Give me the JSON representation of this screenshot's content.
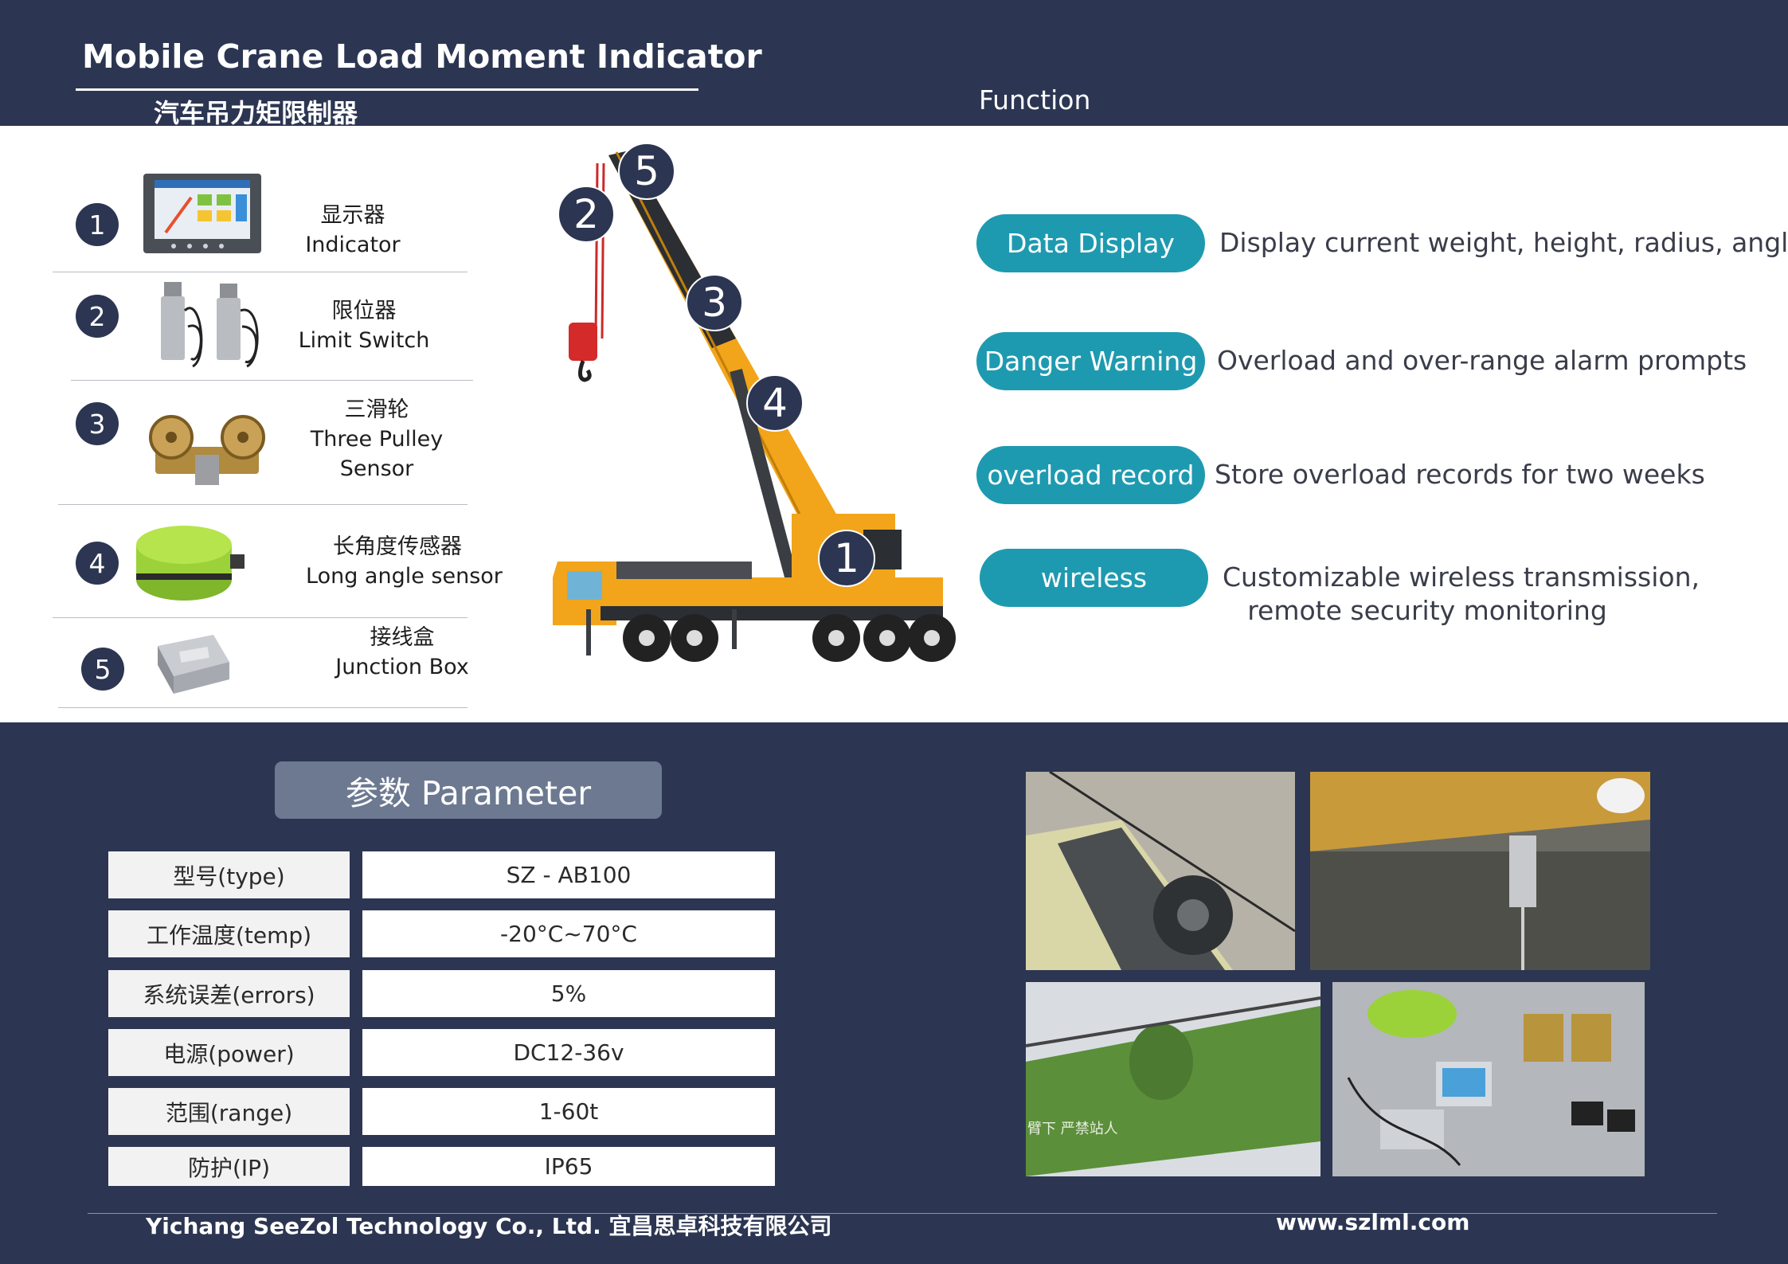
{
  "header": {
    "title": "Mobile Crane Load Moment Indicator",
    "subtitle": "汽车吊力矩限制器",
    "function_label": "Function"
  },
  "components": [
    {
      "num": "1",
      "zh": "显示器",
      "en": "Indicator",
      "icon": "display-unit-icon"
    },
    {
      "num": "2",
      "zh": "限位器",
      "en": "Limit Switch",
      "icon": "limit-switch-icon"
    },
    {
      "num": "3",
      "zh": "三滑轮",
      "en": "Three Pulley",
      "en2": "Sensor",
      "icon": "pulley-sensor-icon"
    },
    {
      "num": "4",
      "zh": "长角度传感器",
      "en": "Long angle sensor",
      "icon": "angle-sensor-icon"
    },
    {
      "num": "5",
      "zh": "接线盒",
      "en": "Junction Box",
      "icon": "junction-box-icon"
    }
  ],
  "crane_badges": [
    "5",
    "2",
    "3",
    "4",
    "1"
  ],
  "functions": [
    {
      "label": "Data Display",
      "desc": "Display current weight, height, radius, angle"
    },
    {
      "label": "Danger Warning",
      "desc": "Overload and over-range alarm prompts"
    },
    {
      "label": "overload record",
      "desc": "Store overload records for two weeks"
    },
    {
      "label": "wireless",
      "desc": "Customizable wireless transmission,",
      "desc2": "remote security monitoring"
    }
  ],
  "parameters": {
    "title": "参数 Parameter",
    "rows": [
      {
        "label": "型号(type)",
        "value": "SZ - AB100"
      },
      {
        "label": "工作温度(temp)",
        "value": "-20°C~70°C"
      },
      {
        "label": "系统误差(errors)",
        "value": "5%"
      },
      {
        "label": "电源(power)",
        "value": "DC12-36v"
      },
      {
        "label": "范围(range)",
        "value": "1-60t"
      },
      {
        "label": "防护(IP)",
        "value": "IP65"
      }
    ]
  },
  "photos": [
    {
      "icon": "pulley-on-boom-photo-icon"
    },
    {
      "icon": "limit-switch-install-photo-icon"
    },
    {
      "icon": "angle-sensor-on-boom-photo-icon",
      "caption": "臂下 严禁站人"
    },
    {
      "icon": "component-kit-photo-icon"
    }
  ],
  "footer": {
    "company": "Yichang SeeZol Technology Co., Ltd. 宜昌思卓科技有限公司",
    "url": "www.szlml.com"
  },
  "colors": {
    "navy": "#2c3652",
    "teal": "#1e9ab0",
    "crane_orange": "#f2a51a",
    "slate": "#6c7990"
  }
}
